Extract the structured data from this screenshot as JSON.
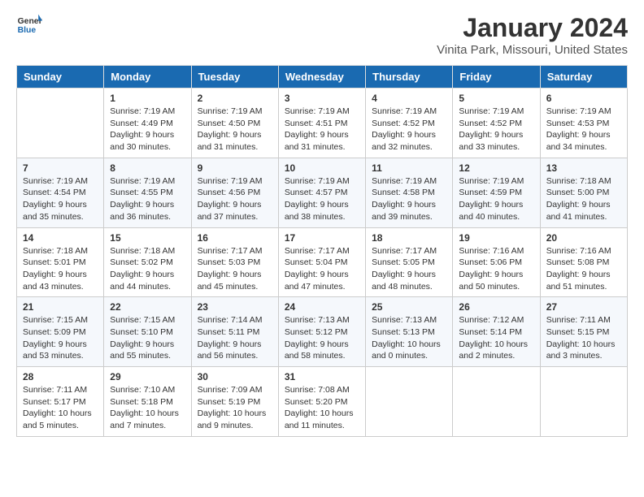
{
  "header": {
    "logo_text_general": "General",
    "logo_text_blue": "Blue",
    "title": "January 2024",
    "subtitle": "Vinita Park, Missouri, United States"
  },
  "columns": [
    "Sunday",
    "Monday",
    "Tuesday",
    "Wednesday",
    "Thursday",
    "Friday",
    "Saturday"
  ],
  "weeks": [
    [
      {
        "day": "",
        "info": ""
      },
      {
        "day": "1",
        "info": "Sunrise: 7:19 AM\nSunset: 4:49 PM\nDaylight: 9 hours\nand 30 minutes."
      },
      {
        "day": "2",
        "info": "Sunrise: 7:19 AM\nSunset: 4:50 PM\nDaylight: 9 hours\nand 31 minutes."
      },
      {
        "day": "3",
        "info": "Sunrise: 7:19 AM\nSunset: 4:51 PM\nDaylight: 9 hours\nand 31 minutes."
      },
      {
        "day": "4",
        "info": "Sunrise: 7:19 AM\nSunset: 4:52 PM\nDaylight: 9 hours\nand 32 minutes."
      },
      {
        "day": "5",
        "info": "Sunrise: 7:19 AM\nSunset: 4:52 PM\nDaylight: 9 hours\nand 33 minutes."
      },
      {
        "day": "6",
        "info": "Sunrise: 7:19 AM\nSunset: 4:53 PM\nDaylight: 9 hours\nand 34 minutes."
      }
    ],
    [
      {
        "day": "7",
        "info": "Sunrise: 7:19 AM\nSunset: 4:54 PM\nDaylight: 9 hours\nand 35 minutes."
      },
      {
        "day": "8",
        "info": "Sunrise: 7:19 AM\nSunset: 4:55 PM\nDaylight: 9 hours\nand 36 minutes."
      },
      {
        "day": "9",
        "info": "Sunrise: 7:19 AM\nSunset: 4:56 PM\nDaylight: 9 hours\nand 37 minutes."
      },
      {
        "day": "10",
        "info": "Sunrise: 7:19 AM\nSunset: 4:57 PM\nDaylight: 9 hours\nand 38 minutes."
      },
      {
        "day": "11",
        "info": "Sunrise: 7:19 AM\nSunset: 4:58 PM\nDaylight: 9 hours\nand 39 minutes."
      },
      {
        "day": "12",
        "info": "Sunrise: 7:19 AM\nSunset: 4:59 PM\nDaylight: 9 hours\nand 40 minutes."
      },
      {
        "day": "13",
        "info": "Sunrise: 7:18 AM\nSunset: 5:00 PM\nDaylight: 9 hours\nand 41 minutes."
      }
    ],
    [
      {
        "day": "14",
        "info": "Sunrise: 7:18 AM\nSunset: 5:01 PM\nDaylight: 9 hours\nand 43 minutes."
      },
      {
        "day": "15",
        "info": "Sunrise: 7:18 AM\nSunset: 5:02 PM\nDaylight: 9 hours\nand 44 minutes."
      },
      {
        "day": "16",
        "info": "Sunrise: 7:17 AM\nSunset: 5:03 PM\nDaylight: 9 hours\nand 45 minutes."
      },
      {
        "day": "17",
        "info": "Sunrise: 7:17 AM\nSunset: 5:04 PM\nDaylight: 9 hours\nand 47 minutes."
      },
      {
        "day": "18",
        "info": "Sunrise: 7:17 AM\nSunset: 5:05 PM\nDaylight: 9 hours\nand 48 minutes."
      },
      {
        "day": "19",
        "info": "Sunrise: 7:16 AM\nSunset: 5:06 PM\nDaylight: 9 hours\nand 50 minutes."
      },
      {
        "day": "20",
        "info": "Sunrise: 7:16 AM\nSunset: 5:08 PM\nDaylight: 9 hours\nand 51 minutes."
      }
    ],
    [
      {
        "day": "21",
        "info": "Sunrise: 7:15 AM\nSunset: 5:09 PM\nDaylight: 9 hours\nand 53 minutes."
      },
      {
        "day": "22",
        "info": "Sunrise: 7:15 AM\nSunset: 5:10 PM\nDaylight: 9 hours\nand 55 minutes."
      },
      {
        "day": "23",
        "info": "Sunrise: 7:14 AM\nSunset: 5:11 PM\nDaylight: 9 hours\nand 56 minutes."
      },
      {
        "day": "24",
        "info": "Sunrise: 7:13 AM\nSunset: 5:12 PM\nDaylight: 9 hours\nand 58 minutes."
      },
      {
        "day": "25",
        "info": "Sunrise: 7:13 AM\nSunset: 5:13 PM\nDaylight: 10 hours\nand 0 minutes."
      },
      {
        "day": "26",
        "info": "Sunrise: 7:12 AM\nSunset: 5:14 PM\nDaylight: 10 hours\nand 2 minutes."
      },
      {
        "day": "27",
        "info": "Sunrise: 7:11 AM\nSunset: 5:15 PM\nDaylight: 10 hours\nand 3 minutes."
      }
    ],
    [
      {
        "day": "28",
        "info": "Sunrise: 7:11 AM\nSunset: 5:17 PM\nDaylight: 10 hours\nand 5 minutes."
      },
      {
        "day": "29",
        "info": "Sunrise: 7:10 AM\nSunset: 5:18 PM\nDaylight: 10 hours\nand 7 minutes."
      },
      {
        "day": "30",
        "info": "Sunrise: 7:09 AM\nSunset: 5:19 PM\nDaylight: 10 hours\nand 9 minutes."
      },
      {
        "day": "31",
        "info": "Sunrise: 7:08 AM\nSunset: 5:20 PM\nDaylight: 10 hours\nand 11 minutes."
      },
      {
        "day": "",
        "info": ""
      },
      {
        "day": "",
        "info": ""
      },
      {
        "day": "",
        "info": ""
      }
    ]
  ]
}
